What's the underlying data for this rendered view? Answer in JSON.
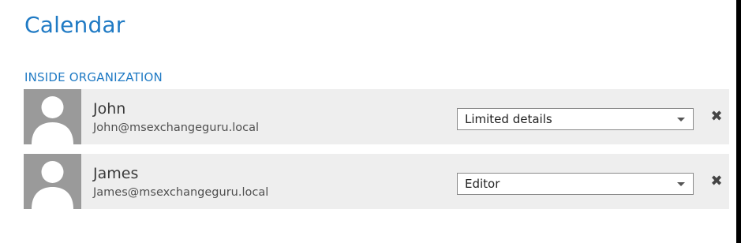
{
  "page": {
    "title": "Calendar",
    "section_label": "INSIDE ORGANIZATION"
  },
  "colors": {
    "accent": "#1f7ac4",
    "row_background": "#eeeeee",
    "avatar_background": "#9a9a9a"
  },
  "permissions": [
    {
      "name": "John",
      "email": "John@msexchangeguru.local",
      "permission": "Limited details",
      "avatar_icon": "person-silhouette-icon",
      "remove_icon": "close-icon",
      "remove_glyph": "✖"
    },
    {
      "name": "James",
      "email": "James@msexchangeguru.local",
      "permission": "Editor",
      "avatar_icon": "person-silhouette-icon",
      "remove_icon": "close-icon",
      "remove_glyph": "✖"
    }
  ]
}
